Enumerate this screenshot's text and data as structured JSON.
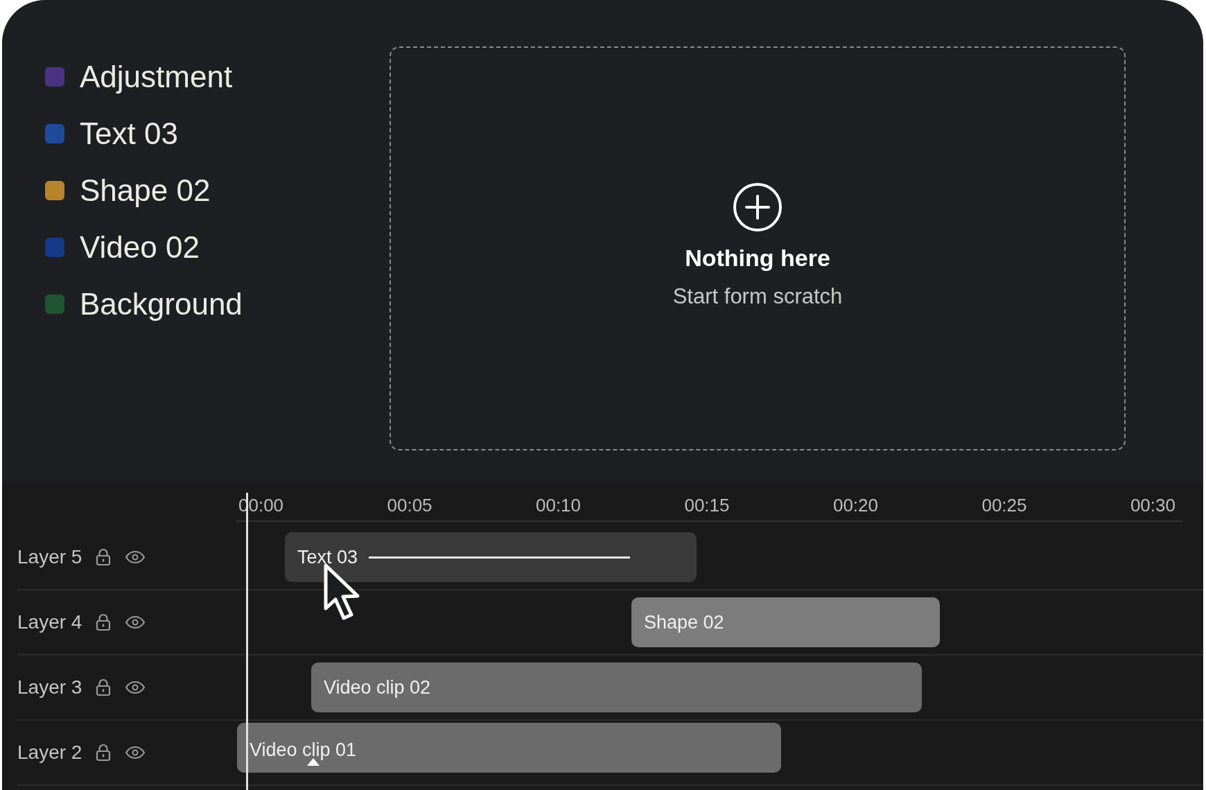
{
  "legend": [
    {
      "label": "Adjustment",
      "color": "#4b3382"
    },
    {
      "label": "Text 03",
      "color": "#1f4a9a"
    },
    {
      "label": "Shape 02",
      "color": "#b5842c"
    },
    {
      "label": "Video 02",
      "color": "#163a88"
    },
    {
      "label": "Background",
      "color": "#1f5530"
    }
  ],
  "empty_state": {
    "title": "Nothing here",
    "subtitle": "Start form scratch"
  },
  "timeline": {
    "ticks": [
      "00:00",
      "00:05",
      "00:10",
      "00:15",
      "00:20",
      "00:25",
      "00:30"
    ],
    "layers": [
      {
        "name": "Layer 5",
        "clip": {
          "label": "Text 03",
          "kind": "text",
          "keyframe": false
        }
      },
      {
        "name": "Layer 4",
        "clip": {
          "label": "Shape 02",
          "kind": "shape",
          "keyframe": false
        }
      },
      {
        "name": "Layer 3",
        "clip": {
          "label": "Video clip 02",
          "kind": "video",
          "keyframe": false
        }
      },
      {
        "name": "Layer 2",
        "clip": {
          "label": "Video clip 01",
          "kind": "video",
          "keyframe": true
        }
      }
    ]
  }
}
